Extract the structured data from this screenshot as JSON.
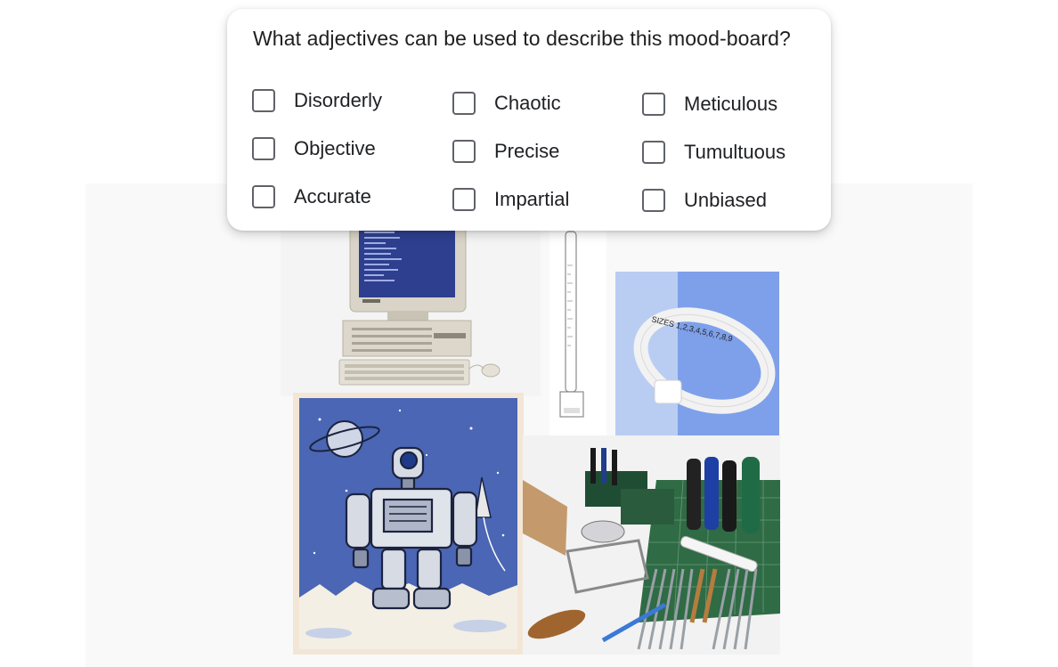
{
  "question": "What adjectives can be used to describe this mood-board?",
  "options": [
    {
      "label": "Disorderly",
      "checked": false
    },
    {
      "label": "Chaotic",
      "checked": false
    },
    {
      "label": "Meticulous",
      "checked": false
    },
    {
      "label": "Objective",
      "checked": false
    },
    {
      "label": "Precise",
      "checked": false
    },
    {
      "label": "Tumultuous",
      "checked": false
    },
    {
      "label": "Accurate",
      "checked": false
    },
    {
      "label": "Impartial",
      "checked": false
    },
    {
      "label": "Unbiased",
      "checked": false
    }
  ],
  "moodboard": {
    "images": [
      {
        "name": "vintage-computer"
      },
      {
        "name": "thermometer-ruler"
      },
      {
        "name": "ring-sizer"
      },
      {
        "name": "retro-robot-poster"
      },
      {
        "name": "jewelry-tools"
      }
    ],
    "ring_sizer_text": "SIZES 1,2,3,4,5,6,7,8,9"
  },
  "colors": {
    "checkbox_border": "#5f6368",
    "robot_bg": "#4a66b4",
    "ring_bg_left": "#b9cdf3",
    "ring_bg_right": "#7ea0ea",
    "cutting_mat": "#2f6b45"
  }
}
